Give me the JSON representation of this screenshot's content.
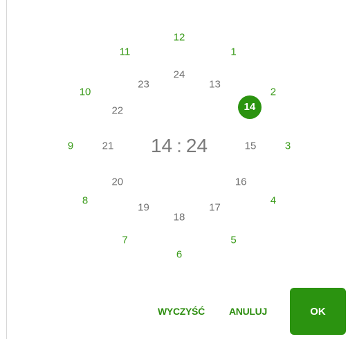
{
  "picker": {
    "selected_hour": "14",
    "time": {
      "hours": "14",
      "separator": ":",
      "minutes": "24"
    },
    "outer_hours": [
      "12",
      "1",
      "2",
      "3",
      "4",
      "5",
      "6",
      "7",
      "8",
      "9",
      "10",
      "11"
    ],
    "inner_hours": [
      "24",
      "13",
      "14",
      "15",
      "16",
      "17",
      "18",
      "19",
      "20",
      "21",
      "22",
      "23"
    ]
  },
  "actions": {
    "clear_label": "WYCZYŚĆ",
    "cancel_label": "ANULUJ",
    "ok_label": "OK"
  },
  "colors": {
    "accent": "#2b9310",
    "outer_text": "#3a9b1a",
    "inner_text": "#707070"
  }
}
